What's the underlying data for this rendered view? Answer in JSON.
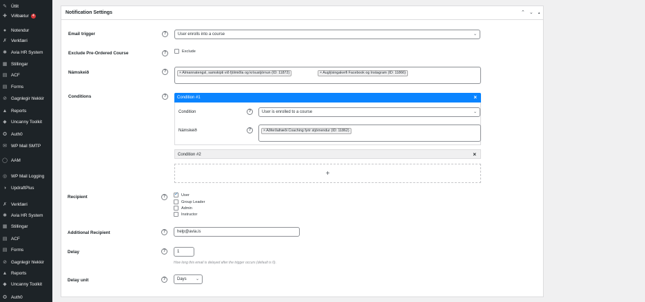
{
  "sidebar": {
    "items": [
      {
        "label": "Útlit",
        "icon": "paintbrush-icon",
        "glyph": "✎"
      },
      {
        "label": "Viðbætur",
        "icon": "plugins-icon",
        "glyph": "✚",
        "badge": "4"
      },
      {
        "label": "Notendur",
        "icon": "users-icon",
        "glyph": "●"
      },
      {
        "label": "Verkfæri",
        "icon": "wrench-icon",
        "glyph": "✗"
      },
      {
        "label": "Avia HR System",
        "icon": "gear-icon",
        "glyph": "✱"
      },
      {
        "label": "Stillingar",
        "icon": "settings-icon",
        "glyph": "▦"
      },
      {
        "label": "ACF",
        "icon": "acf-icon",
        "glyph": "▤"
      },
      {
        "label": "Forms",
        "icon": "forms-icon",
        "glyph": "▤"
      },
      {
        "label": "Gagnlegir hlekkir",
        "icon": "links-icon",
        "glyph": "⊘"
      },
      {
        "label": "Reports",
        "icon": "reports-icon",
        "glyph": "▲"
      },
      {
        "label": "Uncanny Toolkit",
        "icon": "toolkit-icon",
        "glyph": "◆"
      },
      {
        "label": "Auth0",
        "icon": "auth0-icon",
        "glyph": "✪"
      },
      {
        "label": "WP Mail SMTP",
        "icon": "mail-smtp-icon",
        "glyph": "✉"
      },
      {
        "label": "AAM",
        "icon": "aam-icon",
        "glyph": "◯"
      },
      {
        "label": "WP Mail Logging",
        "icon": "mail-logging-icon",
        "glyph": "◎"
      },
      {
        "label": "UpdraftPlus",
        "icon": "updraft-icon",
        "glyph": "◑"
      },
      {
        "label": "Verkfæri",
        "icon": "wrench-icon",
        "glyph": "✗"
      },
      {
        "label": "Avia HR System",
        "icon": "gear-icon",
        "glyph": "✱"
      },
      {
        "label": "Stillingar",
        "icon": "settings-icon",
        "glyph": "▦"
      },
      {
        "label": "ACF",
        "icon": "acf-icon",
        "glyph": "▤"
      },
      {
        "label": "Forms",
        "icon": "forms-icon",
        "glyph": "▤"
      },
      {
        "label": "Gagnlegir hlekkir",
        "icon": "links-icon",
        "glyph": "⊘"
      },
      {
        "label": "Reports",
        "icon": "reports-icon",
        "glyph": "▲"
      },
      {
        "label": "Uncanny Toolkit",
        "icon": "toolkit-icon",
        "glyph": "◆"
      },
      {
        "label": "Auth0",
        "icon": "auth0-icon",
        "glyph": "✪"
      }
    ]
  },
  "panel": {
    "title": "Notification Settings",
    "controls": {
      "up": "⌃",
      "down": "⌄",
      "toggle": "▴"
    }
  },
  "help_glyph": "?",
  "form": {
    "email_trigger": {
      "label": "Email trigger",
      "value": "User enrolls into a course",
      "caret": "⌄"
    },
    "exclude_preordered": {
      "label": "Exclude Pre-Ordered Course",
      "checkbox_label": "Exclude",
      "checked": false
    },
    "course": {
      "label": "Námskeið",
      "tags": [
        "× Almannatengsl, samskipti við fjölmiðla og krísustjórnun (ID: 11872)",
        "× Auglýsingakerfi Facebook og Instagram (ID: 11866)"
      ]
    },
    "conditions": {
      "label": "Conditions",
      "condition1": {
        "title": "Condition #1",
        "close": "×",
        "condition_label": "Condition",
        "condition_value": "User is enrolled to a course",
        "course_label": "Námskeið",
        "course_tags": [
          "× Aðferðafræði Coaching fyrir stjórnendur (ID: 11862)"
        ]
      },
      "condition2": {
        "title": "Condition #2",
        "close": "×"
      },
      "add": "+"
    },
    "recipient": {
      "label": "Recipient",
      "options": [
        {
          "label": "User",
          "checked": true
        },
        {
          "label": "Group Leader",
          "checked": false
        },
        {
          "label": "Admin",
          "checked": false
        },
        {
          "label": "Instructor",
          "checked": false
        }
      ]
    },
    "additional_recipient": {
      "label": "Additional Recipient",
      "value": "help@avia.is"
    },
    "delay": {
      "label": "Delay",
      "value": "1",
      "hint": "How long this email is delayed after the trigger occurs (default is 0)."
    },
    "delay_unit": {
      "label": "Delay unit",
      "value": "Days",
      "caret": "⌄"
    }
  },
  "colors": {
    "accent": "#2271b1",
    "condition_active": "#0a84ff",
    "sidebar_bg": "#1d2327"
  }
}
